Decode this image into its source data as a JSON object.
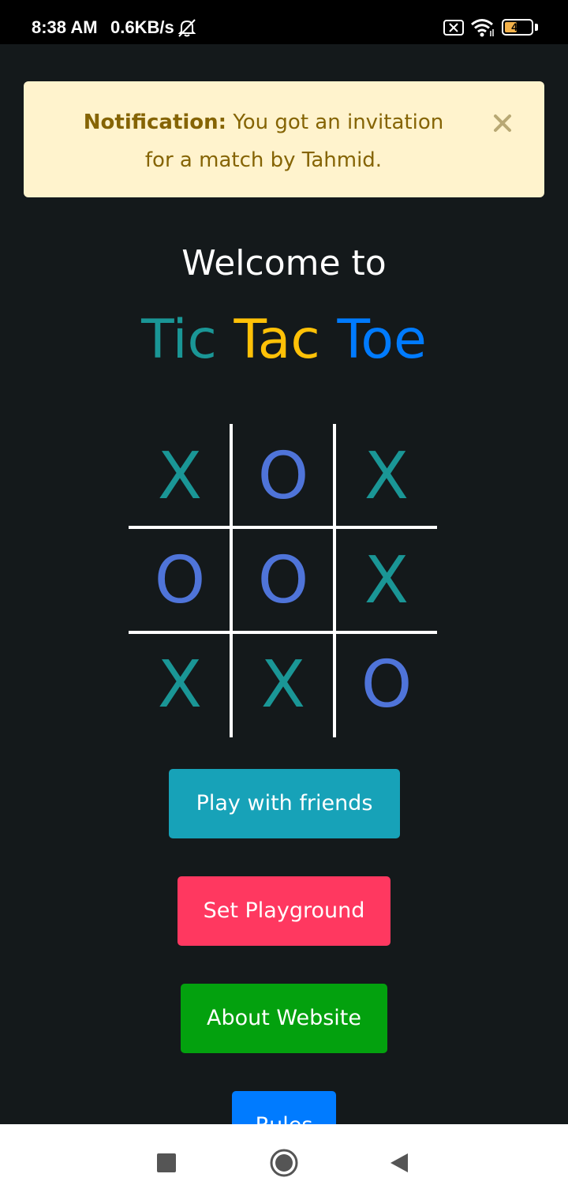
{
  "status_bar": {
    "time": "8:38 AM",
    "network_speed": "0.6KB/s",
    "battery_level": "46",
    "icons": [
      "mute-bell-icon",
      "sim-off-icon",
      "wifi-icon",
      "battery-icon"
    ]
  },
  "notification": {
    "label": "Notification:",
    "message": " You got an invitation for a match by Tahmid.",
    "close_icon": "close-icon",
    "colors": {
      "background": "#fff3cd",
      "text": "#856404"
    }
  },
  "welcome_text": "Welcome to",
  "title_words": [
    {
      "text": "Tic",
      "color": "#1a9696"
    },
    {
      "text": "Tac",
      "color": "#ffc107"
    },
    {
      "text": "Toe",
      "color": "#007bff"
    }
  ],
  "board": {
    "cells": [
      "X",
      "O",
      "X",
      "O",
      "O",
      "X",
      "X",
      "X",
      "O"
    ],
    "colors": {
      "X": "#1a9696",
      "O": "#4f74d9"
    }
  },
  "buttons": [
    {
      "label": "Play with friends",
      "color": "#17a2b8"
    },
    {
      "label": "Set Playground",
      "color": "#ff3860"
    },
    {
      "label": "About Website",
      "color": "#03a10e"
    },
    {
      "label": "Rules",
      "color": "#007bff"
    }
  ],
  "nav_bar": {
    "icons": [
      "recents-square-icon",
      "home-circle-icon",
      "back-triangle-icon"
    ]
  }
}
